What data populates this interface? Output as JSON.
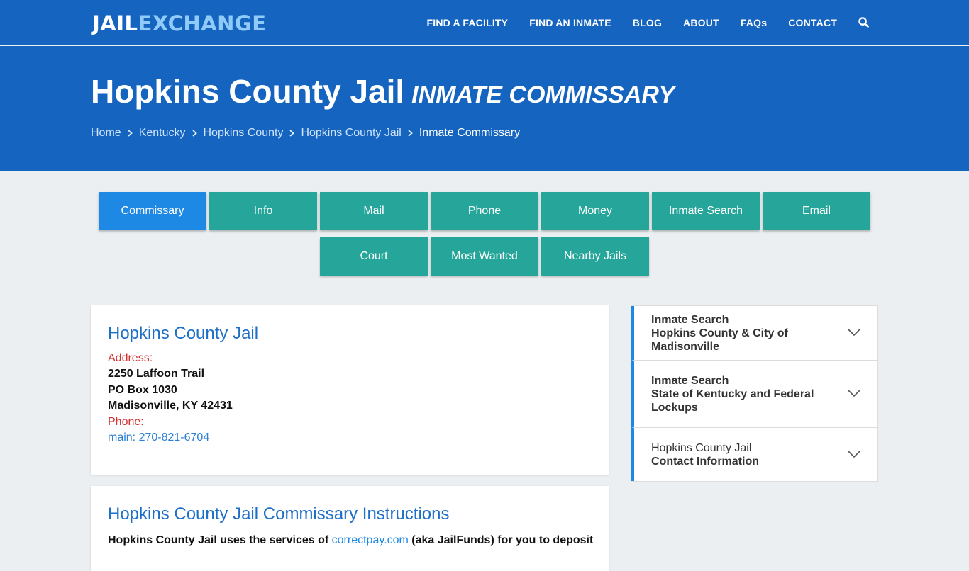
{
  "brand": {
    "part1": "JAIL",
    "part2": "EXCHANGE"
  },
  "nav": {
    "items": [
      "FIND A FACILITY",
      "FIND AN INMATE",
      "BLOG",
      "ABOUT",
      "FAQs",
      "CONTACT"
    ]
  },
  "hero": {
    "title": "Hopkins County Jail",
    "subtitle": "Inmate Commissary"
  },
  "breadcrumb": [
    "Home",
    "Kentucky",
    "Hopkins County",
    "Hopkins County Jail",
    "Inmate Commissary"
  ],
  "tabs": [
    "Commissary",
    "Info",
    "Mail",
    "Phone",
    "Money",
    "Inmate Search",
    "Email",
    "Court",
    "Most Wanted",
    "Nearby Jails"
  ],
  "facility": {
    "name": "Hopkins County Jail",
    "address_label": "Address:",
    "address_lines": [
      "2250 Laffoon Trail",
      "PO Box 1030",
      "Madisonville, KY 42431"
    ],
    "phone_label": "Phone:",
    "phone": "main: 270-821-6704"
  },
  "instructions": {
    "title": "Hopkins County Jail Commissary Instructions",
    "text_before": "Hopkins County Jail uses the services of ",
    "link": "correctpay.com",
    "text_after": " (aka JailFunds) for you to deposit"
  },
  "sidebar": {
    "items": [
      {
        "line1": "Inmate Search",
        "line2": "Hopkins County & City of Madisonville"
      },
      {
        "line1": "Inmate Search",
        "line2": "State of Kentucky and Federal Lockups"
      },
      {
        "line1": "Hopkins County Jail",
        "line2": "Contact Information"
      }
    ]
  },
  "colors": {
    "primary": "#1565c0",
    "tab": "#26a69a",
    "tab_active": "#1e88e5",
    "label_red": "#d32f2f"
  }
}
